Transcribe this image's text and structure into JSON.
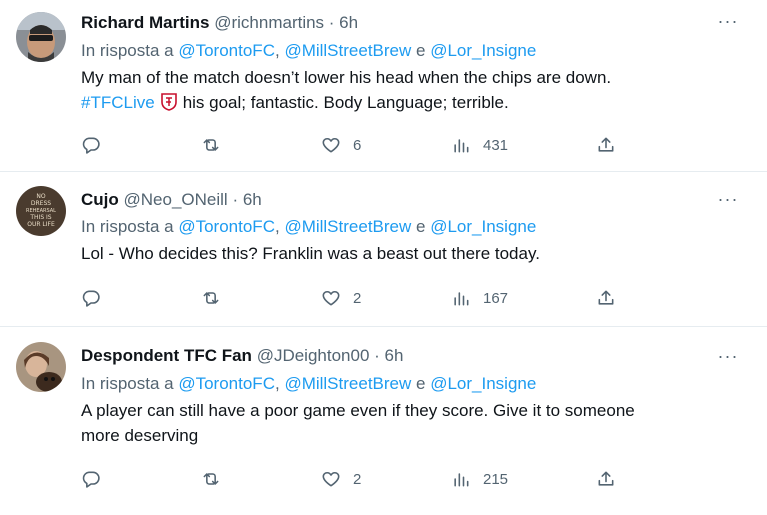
{
  "tweets": [
    {
      "name": "Richard Martins",
      "handle": "@richnmartins",
      "time": "· 6h",
      "more": "···",
      "reply_prefix": "In risposta a",
      "mention1": "@TorontoFC",
      "sep1": ",",
      "mention2": "@MillStreetBrew",
      "conj": "e",
      "mention3": "@Lor_Insigne",
      "text_line1": "My man of the match doesn’t lower his head when the chips are down.",
      "hashtag": "#TFCLive",
      "text_line2": "his goal; fantastic. Body Language; terrible.",
      "likes": "6",
      "views": "431"
    },
    {
      "name": "Cujo",
      "handle": "@Neo_ONeill",
      "time": "· 6h",
      "more": "···",
      "reply_prefix": "In risposta a",
      "mention1": "@TorontoFC",
      "sep1": ",",
      "mention2": "@MillStreetBrew",
      "conj": "e",
      "mention3": "@Lor_Insigne",
      "text": "Lol - Who decides this? Franklin was a beast out there today.",
      "avatar_text": "NO DRESS REHEARSAL THIS IS OUR LIFE",
      "likes": "2",
      "views": "167"
    },
    {
      "name": "Despondent TFC Fan",
      "handle": "@JDeighton00",
      "time": "· 6h",
      "more": "···",
      "reply_prefix": "In risposta a",
      "mention1": "@TorontoFC",
      "sep1": ",",
      "mention2": "@MillStreetBrew",
      "conj": "e",
      "mention3": "@Lor_Insigne",
      "text_line1": "A player can still have a poor game even if they score. Give it to someone",
      "text_line2": "more deserving",
      "likes": "2",
      "views": "215"
    }
  ],
  "icons": {
    "reply": "reply-icon",
    "retweet": "retweet-icon",
    "like": "like-icon",
    "views": "views-icon",
    "share": "share-icon"
  },
  "colors": {
    "link": "#1d9bf0",
    "secondary": "#536471",
    "primary": "#0f1419"
  }
}
